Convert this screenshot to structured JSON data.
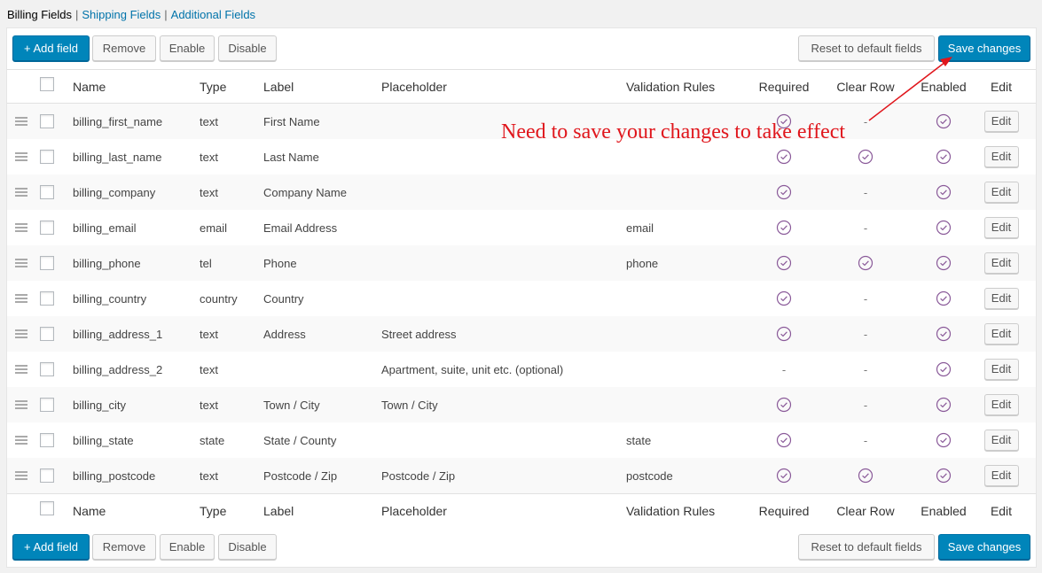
{
  "subnav": {
    "billing": "Billing Fields",
    "shipping": "Shipping Fields",
    "additional": "Additional Fields",
    "separator": "|"
  },
  "toolbar": {
    "add": "+ Add field",
    "remove": "Remove",
    "enable": "Enable",
    "disable": "Disable",
    "reset": "Reset to default fields",
    "save": "Save changes"
  },
  "columns": {
    "name": "Name",
    "type": "Type",
    "label": "Label",
    "placeholder": "Placeholder",
    "validation": "Validation Rules",
    "required": "Required",
    "clear_row": "Clear Row",
    "enabled": "Enabled",
    "edit": "Edit"
  },
  "rows": [
    {
      "name": "billing_first_name",
      "type": "text",
      "label": "First Name",
      "placeholder": "",
      "validation": "",
      "required": true,
      "clear_row": false,
      "enabled": true,
      "edit": "Edit"
    },
    {
      "name": "billing_last_name",
      "type": "text",
      "label": "Last Name",
      "placeholder": "",
      "validation": "",
      "required": true,
      "clear_row": true,
      "enabled": true,
      "edit": "Edit"
    },
    {
      "name": "billing_company",
      "type": "text",
      "label": "Company Name",
      "placeholder": "",
      "validation": "",
      "required": true,
      "clear_row": false,
      "enabled": true,
      "edit": "Edit"
    },
    {
      "name": "billing_email",
      "type": "email",
      "label": "Email Address",
      "placeholder": "",
      "validation": "email",
      "required": true,
      "clear_row": false,
      "enabled": true,
      "edit": "Edit"
    },
    {
      "name": "billing_phone",
      "type": "tel",
      "label": "Phone",
      "placeholder": "",
      "validation": "phone",
      "required": true,
      "clear_row": true,
      "enabled": true,
      "edit": "Edit"
    },
    {
      "name": "billing_country",
      "type": "country",
      "label": "Country",
      "placeholder": "",
      "validation": "",
      "required": true,
      "clear_row": false,
      "enabled": true,
      "edit": "Edit"
    },
    {
      "name": "billing_address_1",
      "type": "text",
      "label": "Address",
      "placeholder": "Street address",
      "validation": "",
      "required": true,
      "clear_row": false,
      "enabled": true,
      "edit": "Edit"
    },
    {
      "name": "billing_address_2",
      "type": "text",
      "label": "",
      "placeholder": "Apartment, suite, unit etc. (optional)",
      "validation": "",
      "required": false,
      "clear_row": false,
      "enabled": true,
      "edit": "Edit"
    },
    {
      "name": "billing_city",
      "type": "text",
      "label": "Town / City",
      "placeholder": "Town / City",
      "validation": "",
      "required": true,
      "clear_row": false,
      "enabled": true,
      "edit": "Edit"
    },
    {
      "name": "billing_state",
      "type": "state",
      "label": "State / County",
      "placeholder": "",
      "validation": "state",
      "required": true,
      "clear_row": false,
      "enabled": true,
      "edit": "Edit"
    },
    {
      "name": "billing_postcode",
      "type": "text",
      "label": "Postcode / Zip",
      "placeholder": "Postcode / Zip",
      "validation": "postcode",
      "required": true,
      "clear_row": true,
      "enabled": true,
      "edit": "Edit"
    }
  ],
  "dash": "-",
  "annotation": "Need to save your changes to take effect",
  "colors": {
    "primary": "#0085ba",
    "link": "#0073aa",
    "check": "#8a5a99",
    "annotation": "#e0161c"
  }
}
